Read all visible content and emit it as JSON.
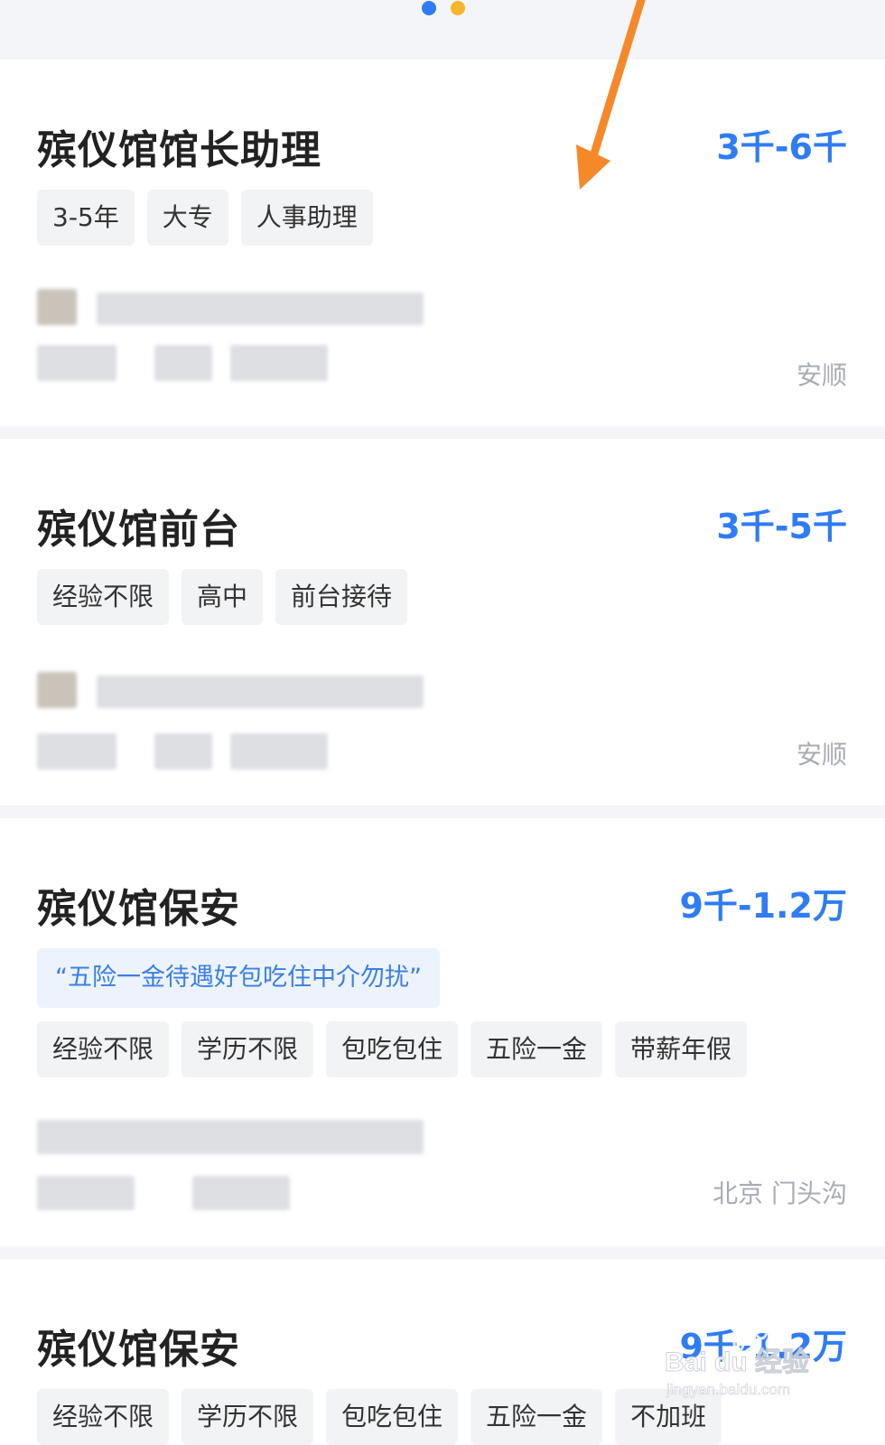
{
  "jobs": [
    {
      "title": "殡仪馆馆长助理",
      "salary": "3千-6千",
      "tags": [
        "3-5年",
        "大专",
        "人事助理"
      ],
      "location": "安顺"
    },
    {
      "title": "殡仪馆前台",
      "salary": "3千-5千",
      "tags": [
        "经验不限",
        "高中",
        "前台接待"
      ],
      "location": "安顺"
    },
    {
      "title": "殡仪馆保安",
      "salary": "9千-1.2万",
      "highlight": "“五险一金待遇好包吃住中介勿扰”",
      "tags": [
        "经验不限",
        "学历不限",
        "包吃包住",
        "五险一金",
        "带薪年假"
      ],
      "location": "北京 门头沟"
    },
    {
      "title": "殡仪馆保安",
      "salary": "9千-1.2万",
      "tags": [
        "经验不限",
        "学历不限",
        "包吃包住",
        "五险一金",
        "不加班"
      ]
    }
  ],
  "watermark": {
    "brand": "Bai du 经验",
    "url": "jingyan.baidu.com"
  },
  "colors": {
    "accent": "#2f7cf6",
    "arrow": "#f5892a",
    "highlight_text": "#3b7fe4"
  },
  "icons": [
    "carousel-dot-icon",
    "annotation-arrow-icon",
    "baidu-paw-icon"
  ]
}
